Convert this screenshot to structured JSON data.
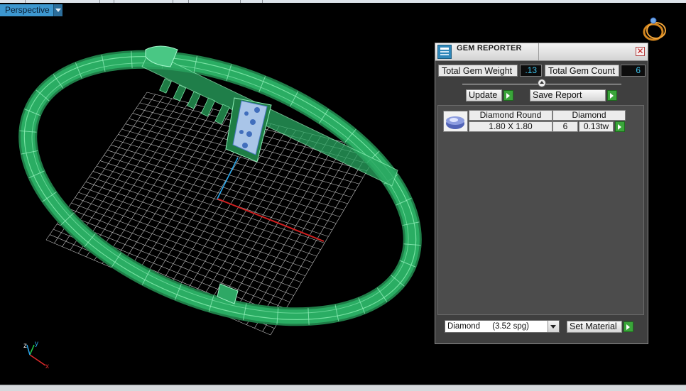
{
  "viewport": {
    "label": "Perspective"
  },
  "axes": {
    "x": "x",
    "y": "y",
    "z": "z"
  },
  "gem_reporter": {
    "title": "GEM REPORTER",
    "close_symbol": "✕",
    "total_weight_label": "Total Gem Weight",
    "total_weight_value": ".13",
    "total_count_label": "Total Gem Count",
    "total_count_value": "6",
    "update_label": "Update",
    "save_report_label": "Save Report",
    "gems": [
      {
        "name": "Diamond Round",
        "material": "Diamond",
        "size": "1.80 X 1.80",
        "count": "6",
        "weight": "0.13tw"
      }
    ],
    "material_select": {
      "value": "Diamond",
      "spg": "(3.52 spg)"
    },
    "set_material_label": "Set Material"
  },
  "icons": {
    "ring": "ring-icon",
    "gem_reporter_logo": "gem-reporter-logo-icon",
    "close": "close-icon",
    "go": "go-arrow-icon",
    "gem_thumb": "diamond-round-icon",
    "dropdown": "chevron-down-icon"
  },
  "colors": {
    "viewport_tab": "#3d97cf",
    "panel_bg": "#3f3f3f",
    "value_text": "#3fc4ee",
    "go_button": "#3aa53a",
    "bangle": "#2db569",
    "grid": "#d8d8d8",
    "axis_x": "#e02a2a",
    "axis_y": "#24d44c",
    "axis_z": "#2aa6ea"
  }
}
